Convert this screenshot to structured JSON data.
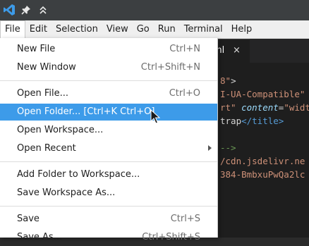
{
  "titlebar": {
    "icons": [
      "vscode-logo-icon",
      "pin-icon",
      "double-chevron-up-icon"
    ]
  },
  "menubar": {
    "items": [
      "File",
      "Edit",
      "Selection",
      "View",
      "Go",
      "Run",
      "Terminal",
      "Help"
    ],
    "active": "File"
  },
  "editor": {
    "tab": {
      "label": "ml",
      "close": "×"
    },
    "lines": [
      {
        "segments": [
          {
            "cls": "c-str",
            "t": "8\""
          },
          {
            "cls": "c-plain",
            "t": ">"
          }
        ]
      },
      {
        "segments": [
          {
            "cls": "c-str",
            "t": "I-UA-Compatible\""
          }
        ]
      },
      {
        "segments": [
          {
            "cls": "c-str",
            "t": "rt\""
          },
          {
            "cls": "c-plain",
            "t": " "
          },
          {
            "cls": "c-kw",
            "t": "content"
          },
          {
            "cls": "c-plain",
            "t": "="
          },
          {
            "cls": "c-str",
            "t": "\"widt"
          }
        ]
      },
      {
        "segments": [
          {
            "cls": "c-plain",
            "t": "trap"
          },
          {
            "cls": "c-tag",
            "t": "</title>"
          }
        ]
      },
      {
        "segments": []
      },
      {
        "segments": [
          {
            "cls": "c-comment",
            "t": "-->"
          }
        ]
      },
      {
        "segments": [
          {
            "cls": "c-str",
            "t": "/cdn.jsdelivr.ne"
          }
        ]
      },
      {
        "segments": [
          {
            "cls": "c-str",
            "t": "384-BmbxuPwQa2lc"
          }
        ]
      }
    ]
  },
  "file_menu": {
    "items": [
      {
        "label": "New File",
        "shortcut": "Ctrl+N"
      },
      {
        "label": "New Window",
        "shortcut": "Ctrl+Shift+N"
      },
      {
        "label": "Open File...",
        "shortcut": "Ctrl+O"
      },
      {
        "label": "Open Folder... [Ctrl+K Ctrl+O]",
        "shortcut": ""
      },
      {
        "label": "Open Workspace...",
        "shortcut": ""
      },
      {
        "label": "Open Recent",
        "shortcut": "",
        "submenu": true
      },
      {
        "label": "Add Folder to Workspace...",
        "shortcut": ""
      },
      {
        "label": "Save Workspace As...",
        "shortcut": ""
      },
      {
        "label": "Save",
        "shortcut": "Ctrl+S"
      },
      {
        "label": "Save As...",
        "shortcut": "Ctrl+Shift+S"
      }
    ],
    "highlighted": "Open Folder... [Ctrl+K Ctrl+O]"
  },
  "colors": {
    "highlight": "#3d9be9",
    "titlebar": "#3c3f41",
    "editor_bg": "#1e1e1e",
    "vscode_blue": "#3d9be9"
  }
}
